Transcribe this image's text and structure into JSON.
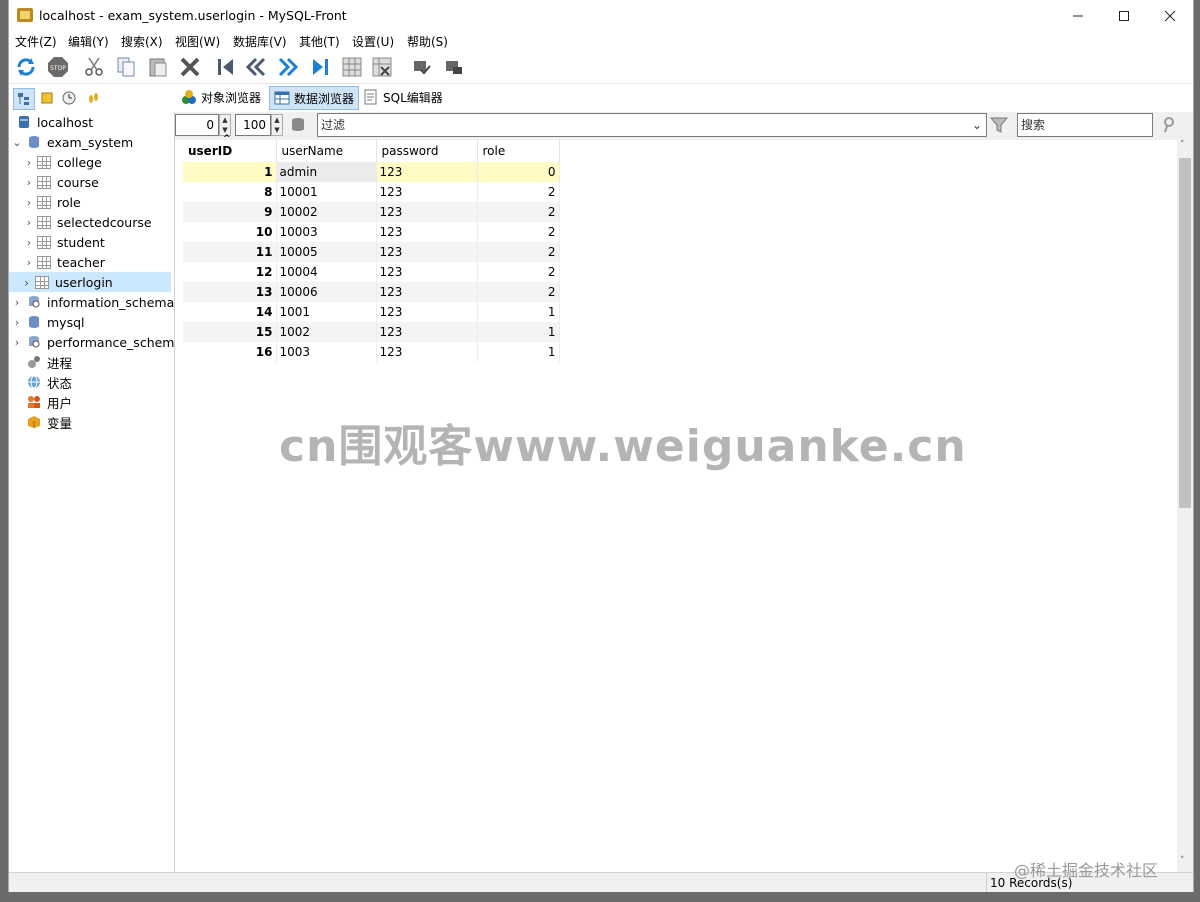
{
  "window": {
    "title": "localhost - exam_system.userlogin - MySQL-Front"
  },
  "menu": [
    "文件(Z)",
    "编辑(Y)",
    "搜索(X)",
    "视图(W)",
    "数据库(V)",
    "其他(T)",
    "设置(U)",
    "帮助(S)"
  ],
  "views": {
    "object_browser": "对象浏览器",
    "data_browser": "数据浏览器",
    "sql_editor": "SQL编辑器"
  },
  "tree": {
    "root": "localhost",
    "db": "exam_system",
    "tables": [
      "college",
      "course",
      "role",
      "selectedcourse",
      "student",
      "teacher",
      "userlogin"
    ],
    "other_dbs": [
      "information_schema",
      "mysql",
      "performance_schema"
    ],
    "extras": [
      "进程",
      "状态",
      "用户",
      "变量"
    ]
  },
  "filter": {
    "offset": "0",
    "limit": "100",
    "filter_placeholder": "过滤",
    "search_placeholder": "搜索"
  },
  "table": {
    "columns": [
      "userID",
      "userName",
      "password",
      "role"
    ],
    "rows": [
      [
        "1",
        "admin",
        "123",
        "0"
      ],
      [
        "8",
        "10001",
        "123",
        "2"
      ],
      [
        "9",
        "10002",
        "123",
        "2"
      ],
      [
        "10",
        "10003",
        "123",
        "2"
      ],
      [
        "11",
        "10005",
        "123",
        "2"
      ],
      [
        "12",
        "10004",
        "123",
        "2"
      ],
      [
        "13",
        "10006",
        "123",
        "2"
      ],
      [
        "14",
        "1001",
        "123",
        "1"
      ],
      [
        "15",
        "1002",
        "123",
        "1"
      ],
      [
        "16",
        "1003",
        "123",
        "1"
      ]
    ]
  },
  "watermark": "cn围观客www.weiguanke.cn",
  "juejin": "@稀土掘金技术社区",
  "status": {
    "records": "10 Records(s)"
  },
  "colors": {
    "selection": "#cce8ff",
    "row_highlight": "#fffbc4",
    "active_tab": "#cfe4f7"
  }
}
